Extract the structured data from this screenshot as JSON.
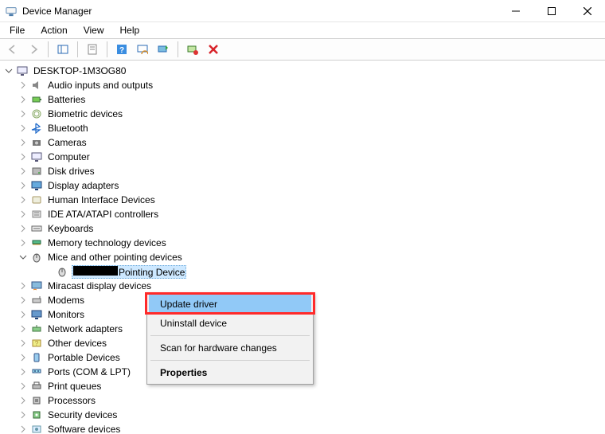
{
  "window": {
    "title": "Device Manager",
    "controls": {
      "minimize": "–",
      "maximize": "☐",
      "close": "✕"
    }
  },
  "menu": {
    "file": "File",
    "action": "Action",
    "view": "View",
    "help": "Help"
  },
  "toolbar": {
    "back": "Back",
    "forward": "Forward",
    "show_hide_tree": "Show/Hide console tree",
    "properties": "Properties",
    "help": "Help",
    "scan": "Scan for hardware changes",
    "update_driver": "Update driver",
    "uninstall": "Uninstall device",
    "delete": "Remove"
  },
  "tree": {
    "root": {
      "label": "DESKTOP-1M3OG80"
    },
    "items": [
      {
        "label": "Audio inputs and outputs",
        "icon": "speaker"
      },
      {
        "label": "Batteries",
        "icon": "battery"
      },
      {
        "label": "Biometric devices",
        "icon": "fingerprint"
      },
      {
        "label": "Bluetooth",
        "icon": "bluetooth"
      },
      {
        "label": "Cameras",
        "icon": "camera"
      },
      {
        "label": "Computer",
        "icon": "computer"
      },
      {
        "label": "Disk drives",
        "icon": "disk"
      },
      {
        "label": "Display adapters",
        "icon": "display"
      },
      {
        "label": "Human Interface Devices",
        "icon": "hid"
      },
      {
        "label": "IDE ATA/ATAPI controllers",
        "icon": "ide"
      },
      {
        "label": "Keyboards",
        "icon": "keyboard"
      },
      {
        "label": "Memory technology devices",
        "icon": "memory"
      },
      {
        "label": "Mice and other pointing devices",
        "icon": "mouse",
        "expanded": true
      },
      {
        "label": "Miracast display devices",
        "icon": "miracast"
      },
      {
        "label": "Modems",
        "icon": "modem"
      },
      {
        "label": "Monitors",
        "icon": "monitor"
      },
      {
        "label": "Network adapters",
        "icon": "network"
      },
      {
        "label": "Other devices",
        "icon": "other"
      },
      {
        "label": "Portable Devices",
        "icon": "portable"
      },
      {
        "label": "Ports (COM & LPT)",
        "icon": "ports"
      },
      {
        "label": "Print queues",
        "icon": "printer"
      },
      {
        "label": "Processors",
        "icon": "cpu"
      },
      {
        "label": "Security devices",
        "icon": "security"
      },
      {
        "label": "Software devices",
        "icon": "software"
      }
    ],
    "mouse_child": {
      "suffix": "Pointing Device",
      "selected": true
    }
  },
  "context_menu": {
    "update": "Update driver",
    "uninstall": "Uninstall device",
    "scan": "Scan for hardware changes",
    "properties": "Properties"
  },
  "colors": {
    "highlight": "#91c9f7",
    "focus_ring": "#ff2a2a"
  }
}
